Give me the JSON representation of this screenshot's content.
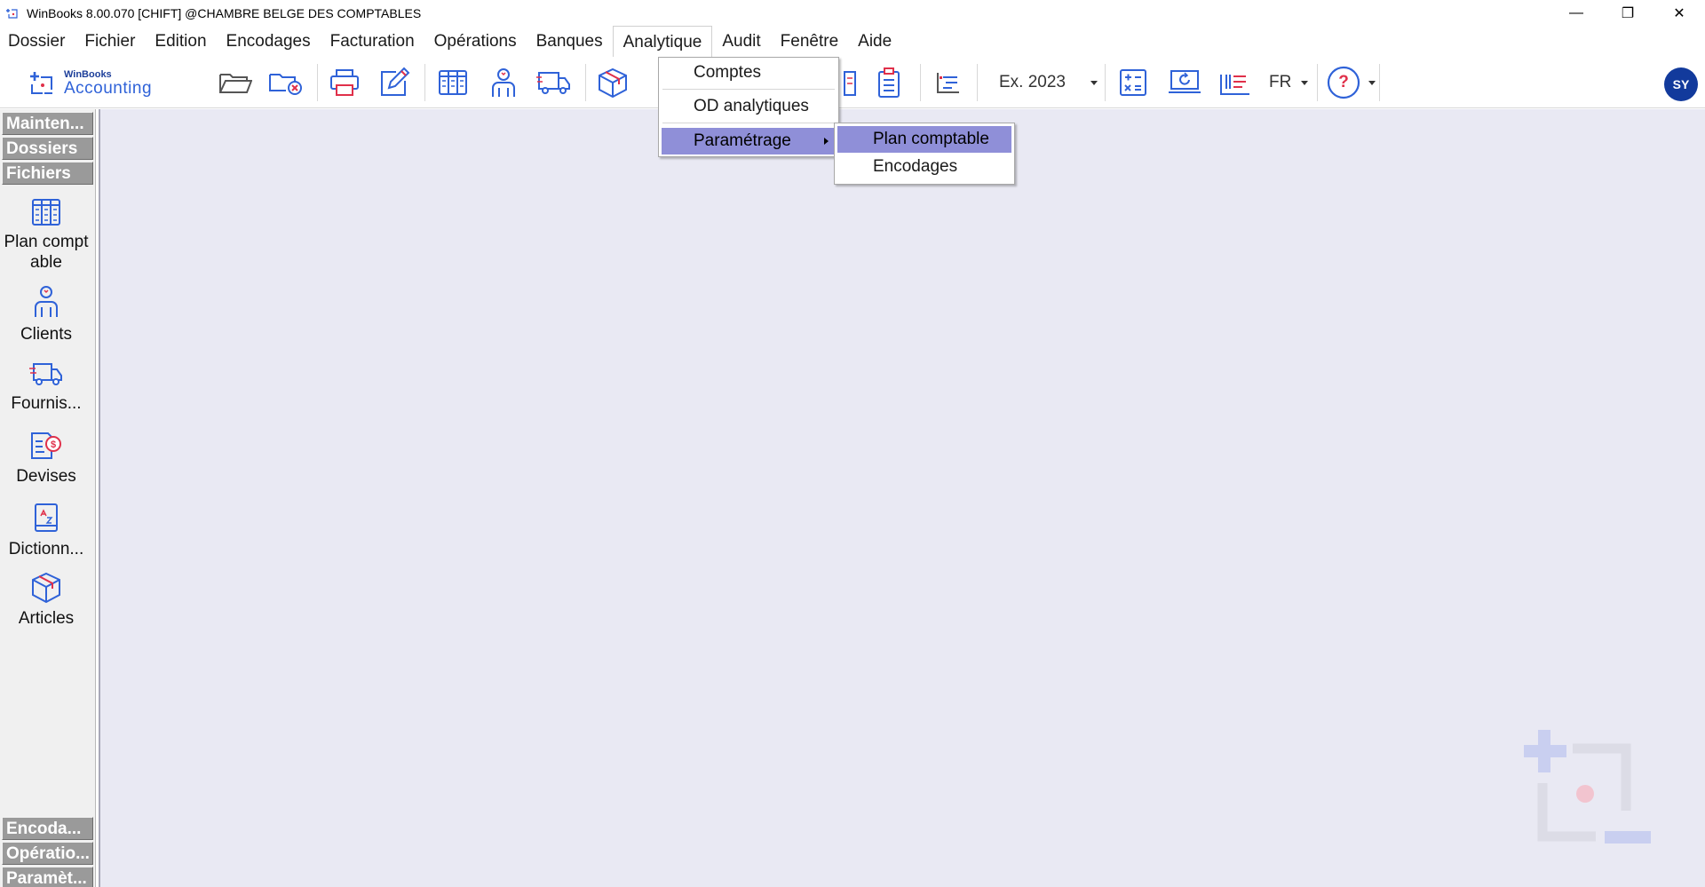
{
  "window": {
    "title": "WinBooks 8.00.070 [CHIFT] @CHAMBRE BELGE DES COMPTABLES",
    "controls": {
      "minimize": "—",
      "restore": "❐",
      "close": "✕"
    }
  },
  "menubar": {
    "items": [
      "Dossier",
      "Fichier",
      "Edition",
      "Encodages",
      "Facturation",
      "Opérations",
      "Banques",
      "Analytique",
      "Audit",
      "Fenêtre",
      "Aide"
    ],
    "open_item": "Analytique"
  },
  "toolbar": {
    "logo_small": "WinBooks",
    "logo_big": "Accounting",
    "exercise": "Ex. 2023",
    "language": "FR",
    "help": "?",
    "avatar": "SY"
  },
  "leftpanel": {
    "sections_top": [
      "Mainten...",
      "Dossiers",
      "Fichiers"
    ],
    "files": [
      {
        "label": "Plan comptable",
        "icon": "ledger-columns-icon"
      },
      {
        "label": "Clients",
        "icon": "user-icon"
      },
      {
        "label": "Fournis...",
        "icon": "truck-icon"
      },
      {
        "label": "Devises",
        "icon": "currency-document-icon"
      },
      {
        "label": "Dictionn...",
        "icon": "dictionary-icon"
      },
      {
        "label": "Articles",
        "icon": "package-icon"
      }
    ],
    "sections_bottom": [
      "Encoda...",
      "Opératio...",
      "Paramèt..."
    ]
  },
  "analytique_menu": {
    "items": [
      "Comptes",
      "OD analytiques",
      "Paramétrage"
    ],
    "highlighted": "Paramétrage"
  },
  "parametrage_submenu": {
    "items": [
      "Plan comptable",
      "Encodages"
    ],
    "highlighted": "Plan comptable"
  },
  "colors": {
    "accent_blue": "#2f62d8",
    "accent_red": "#e0304a",
    "menu_highlight": "#8f8fd8",
    "workspace": "#e9e9f3"
  }
}
